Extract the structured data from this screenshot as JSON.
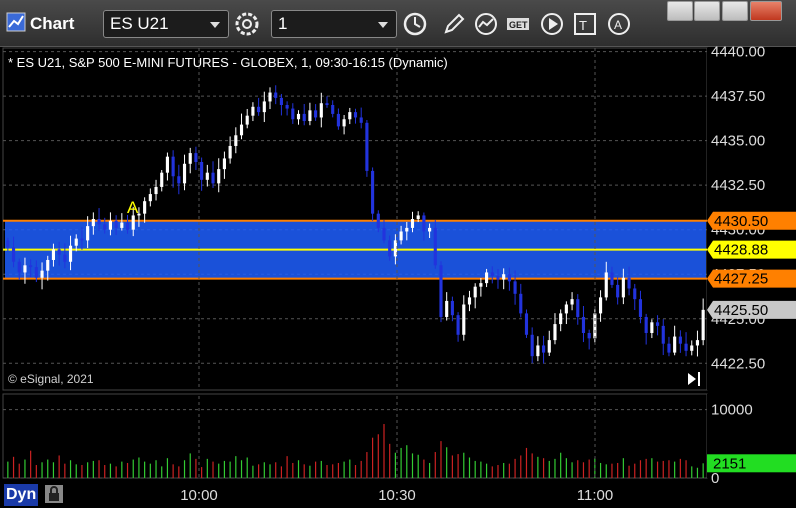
{
  "toolbar": {
    "app_title": "Chart",
    "symbol_value": "ES U21",
    "interval_value": "1",
    "icons": [
      "chart-app-icon",
      "gear-icon",
      "clock-icon",
      "pencil-icon",
      "study-icon",
      "get-icon",
      "play-icon",
      "text-tool-icon",
      "alert-icon",
      "restore-icon",
      "minimize-icon",
      "maximize-icon",
      "close-icon"
    ]
  },
  "chart": {
    "title": "* ES U21, S&P 500 E-MINI FUTURES - GLOBEX, 1, 09:30-16:15 (Dynamic)",
    "copyright": "© eSignal, 2021",
    "annotation": "A",
    "dyn_label": "Dyn"
  },
  "colors": {
    "background": "#000000",
    "bull": "#ffffff",
    "bear": "#2233dd",
    "zone": "#1f5fff",
    "orange": "#ff8000",
    "yellow": "#ffff00",
    "gray_tag": "#c8c8c8",
    "vol_up": "#33cc33",
    "vol_down": "#cc2222",
    "grid": "#555555"
  },
  "chart_data": {
    "type": "candlestick",
    "symbol": "ES U21",
    "interval": "1",
    "price_axis": {
      "ticks": [
        "4440.00",
        "4437.50",
        "4435.00",
        "4432.50",
        "4430.00",
        "4427.50",
        "4425.00",
        "4422.50"
      ],
      "ylim": [
        4421.0,
        4440.2
      ]
    },
    "time_axis": {
      "ticks": [
        "10:00",
        "10:30",
        "11:00"
      ]
    },
    "price_tags": [
      {
        "value": "4430.50",
        "color": "#ff8000"
      },
      {
        "value": "4428.88",
        "color": "#ffff00"
      },
      {
        "value": "4427.25",
        "color": "#ff8000"
      },
      {
        "value": "4425.50",
        "color": "#c8c8c8"
      }
    ],
    "levels": {
      "upper": 4430.5,
      "middle": 4428.88,
      "lower": 4427.25
    },
    "volume_axis": {
      "ticks": [
        "10000",
        "0"
      ],
      "ylim": [
        0,
        12000
      ]
    },
    "volume_tag": "2151",
    "closes": [
      4429.0,
      4428.2,
      4427.6,
      4428.0,
      4427.9,
      4427.3,
      4427.7,
      4428.3,
      4428.9,
      4428.6,
      4428.2,
      4429.1,
      4429.5,
      4429.4,
      4430.2,
      4430.6,
      4430.3,
      4430.0,
      4430.5,
      4430.1,
      4430.4,
      4430.0,
      4430.8,
      4430.9,
      4431.6,
      4432.0,
      4432.4,
      4433.2,
      4434.1,
      4433.0,
      4432.6,
      4433.7,
      4434.3,
      4433.8,
      4432.8,
      4433.2,
      4432.6,
      4433.4,
      4434.0,
      4434.7,
      4435.3,
      4435.9,
      4436.4,
      4436.9,
      4436.6,
      4437.2,
      4437.7,
      4437.4,
      4437.0,
      4436.8,
      4436.2,
      4436.5,
      4436.1,
      4436.7,
      4436.3,
      4437.1,
      4437.0,
      4436.5,
      4435.8,
      4436.2,
      4436.6,
      4436.3,
      4436.0,
      4433.3,
      4430.9,
      4430.1,
      4429.4,
      4428.5,
      4429.4,
      4429.9,
      4430.1,
      4430.6,
      4430.8,
      4429.9,
      4430.1,
      4428.0,
      4425.1,
      4426.0,
      4425.2,
      4424.1,
      4425.8,
      4426.2,
      4426.8,
      4427.0,
      4427.6,
      4427.4,
      4427.2,
      4427.5,
      4427.1,
      4426.4,
      4425.3,
      4424.1,
      4422.9,
      4423.5,
      4423.1,
      4423.8,
      4424.7,
      4425.3,
      4425.8,
      4426.1,
      4425.1,
      4424.2,
      4423.9,
      4425.3,
      4426.2,
      4427.6,
      4426.9,
      4426.2,
      4427.3,
      4426.7,
      4426.1,
      4425.1,
      4424.2,
      4424.8,
      4424.6,
      4423.6,
      4423.1,
      4424.0,
      4423.6,
      4423.2,
      4423.5,
      4423.8,
      4425.5
    ],
    "volumes": [
      2400,
      3100,
      2100,
      2700,
      4000,
      1900,
      2300,
      2700,
      2300,
      3300,
      2100,
      2600,
      2000,
      1900,
      2300,
      2500,
      2600,
      1900,
      2100,
      1700,
      2400,
      2200,
      2700,
      3000,
      2400,
      2100,
      2600,
      1700,
      2900,
      2000,
      1700,
      2600,
      3600,
      2800,
      1600,
      2800,
      2400,
      2100,
      2500,
      2400,
      3200,
      2600,
      3000,
      1800,
      2000,
      2300,
      2000,
      2300,
      1700,
      3200,
      2200,
      2600,
      2000,
      1800,
      2400,
      2500,
      1900,
      2000,
      2200,
      2400,
      2700,
      1900,
      2500,
      3800,
      5900,
      6400,
      7900,
      5000,
      3700,
      4400,
      4800,
      3600,
      3400,
      2700,
      2200,
      3800,
      5400,
      4500,
      3300,
      3500,
      3700,
      3000,
      2500,
      2400,
      2100,
      1700,
      1900,
      2200,
      2100,
      2800,
      3300,
      4400,
      3600,
      3100,
      2900,
      2500,
      2800,
      3700,
      2900,
      2300,
      2600,
      2300,
      2700,
      2900,
      2200,
      2000,
      2100,
      2200,
      2900,
      1800,
      2100,
      2600,
      2800,
      2900,
      2400,
      2500,
      2600,
      2400,
      2800,
      2600,
      1700,
      1500,
      2151
    ]
  }
}
